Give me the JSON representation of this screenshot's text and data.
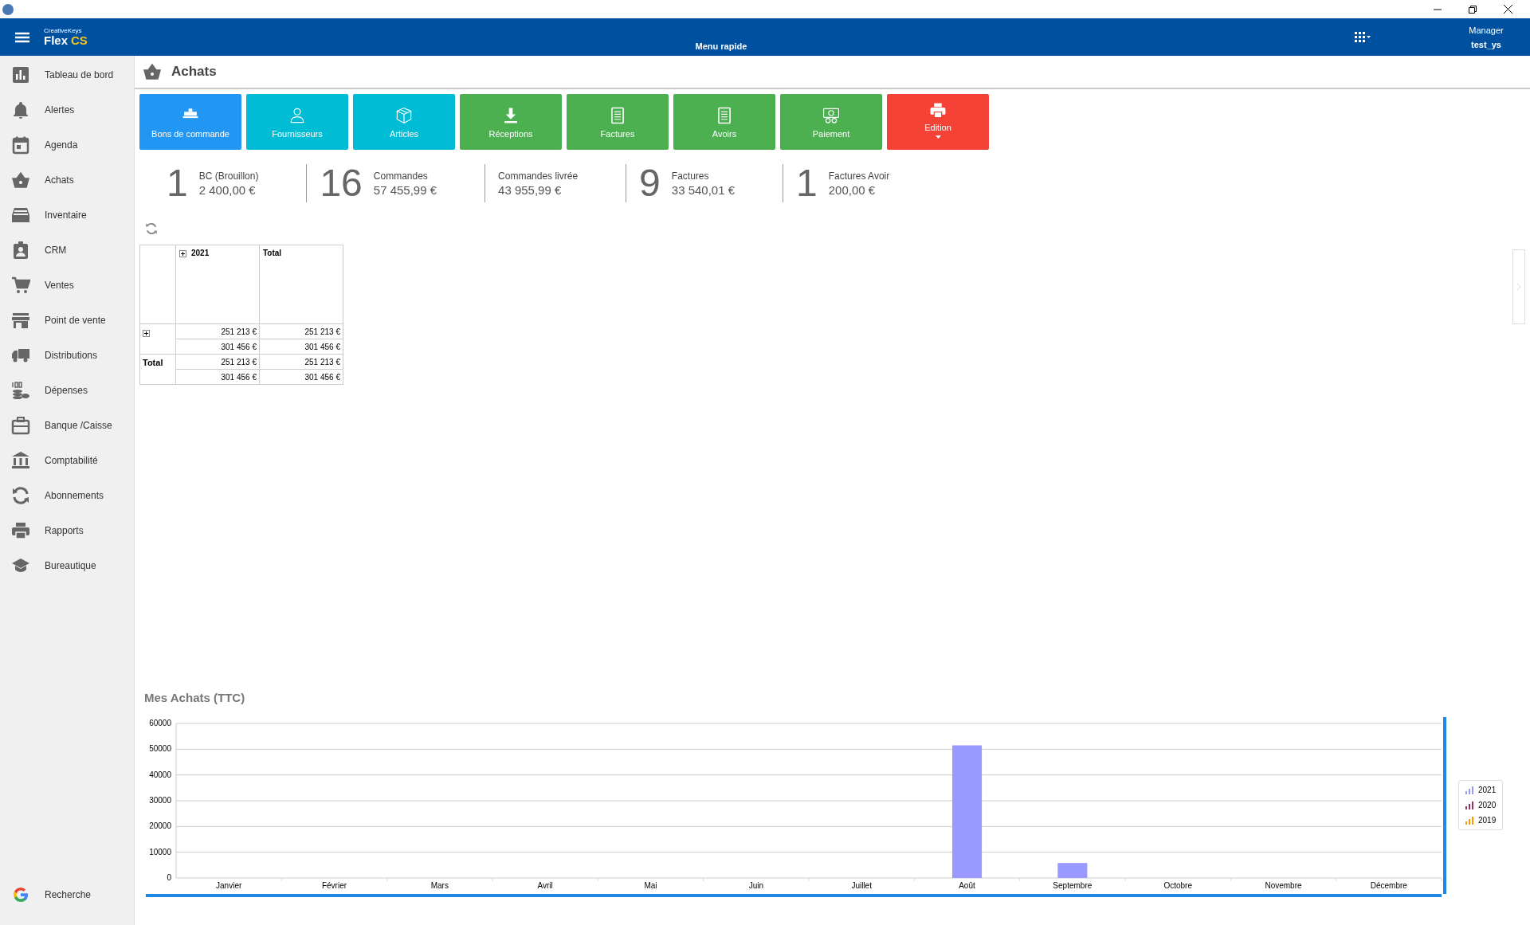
{
  "header": {
    "brand_small": "CreativeKeys",
    "brand_name": "Flex",
    "brand_suffix": "CS",
    "center": "Menu rapide",
    "role": "Manager",
    "user": "test_ys"
  },
  "sidebar": {
    "items": [
      {
        "label": "Tableau de bord",
        "kind": "chart"
      },
      {
        "label": "Alertes",
        "kind": "bell"
      },
      {
        "label": "Agenda",
        "kind": "calendar"
      },
      {
        "label": "Achats",
        "kind": "basket"
      },
      {
        "label": "Inventaire",
        "kind": "tray"
      },
      {
        "label": "CRM",
        "kind": "badge"
      },
      {
        "label": "Ventes",
        "kind": "cart"
      },
      {
        "label": "Point de vente",
        "kind": "store"
      },
      {
        "label": "Distributions",
        "kind": "truck"
      },
      {
        "label": "Dépenses",
        "kind": "coins"
      },
      {
        "label": "Banque /Caisse",
        "kind": "briefcase"
      },
      {
        "label": "Comptabilité",
        "kind": "bank"
      },
      {
        "label": "Abonnements",
        "kind": "sync"
      },
      {
        "label": "Rapports",
        "kind": "printer"
      },
      {
        "label": "Bureautique",
        "kind": "cap"
      }
    ],
    "search": {
      "label": "Recherche"
    }
  },
  "page": {
    "title": "Achats"
  },
  "tiles": [
    {
      "label": "Bons de commande",
      "kind": "pallet",
      "color": "#2196f3"
    },
    {
      "label": "Fournisseurs",
      "kind": "person",
      "color": "#00bcd4"
    },
    {
      "label": "Articles",
      "kind": "box",
      "color": "#00bcd4"
    },
    {
      "label": "Réceptions",
      "kind": "download",
      "color": "#4caf50"
    },
    {
      "label": "Factures",
      "kind": "doc",
      "color": "#4caf50"
    },
    {
      "label": "Avoirs",
      "kind": "doc",
      "color": "#4caf50"
    },
    {
      "label": "Paiement",
      "kind": "money",
      "color": "#4caf50"
    },
    {
      "label": "Edition",
      "kind": "printer",
      "color": "#f44336",
      "dropdown": true
    }
  ],
  "stats": [
    {
      "count": "1",
      "label": "BC (Brouillon)",
      "amount": "2 400,00 €"
    },
    {
      "count": "16",
      "label": "Commandes",
      "amount": "57 455,99 €"
    },
    {
      "label": "Commandes livrée",
      "amount": "43 955,99 €"
    },
    {
      "count": "9",
      "label": "Factures",
      "amount": "33 540,01 €"
    },
    {
      "count": "1",
      "label": "Factures Avoir",
      "amount": "200,00 €"
    }
  ],
  "pivot": {
    "columns": [
      {
        "label": "2021",
        "expandable": true
      },
      {
        "label": "Total",
        "expandable": false
      }
    ],
    "rows": [
      {
        "label": "",
        "expandable": true,
        "values": [
          [
            "251 213 €",
            "251 213 €"
          ],
          [
            "301 456 €",
            "301 456 €"
          ]
        ]
      },
      {
        "label": "Total",
        "expandable": false,
        "values": [
          [
            "251 213 €",
            "251 213 €"
          ],
          [
            "301 456 €",
            "301 456 €"
          ]
        ]
      }
    ]
  },
  "chart": {
    "title": "Mes Achats (TTC)",
    "chart_data": {
      "type": "bar",
      "categories": [
        "Janvier",
        "Février",
        "Mars",
        "Avril",
        "Mai",
        "Juin",
        "Juillet",
        "Août",
        "Septembre",
        "Octobre",
        "Novembre",
        "Décembre"
      ],
      "series": [
        {
          "name": "2021",
          "color": "#9999ff",
          "values": [
            0,
            0,
            0,
            0,
            0,
            0,
            0,
            51500,
            5800,
            0,
            0,
            0
          ]
        },
        {
          "name": "2020",
          "color": "#993366",
          "values": [
            null,
            null,
            null,
            null,
            null,
            null,
            null,
            null,
            null,
            null,
            null,
            null
          ]
        },
        {
          "name": "2019",
          "color": "#ff9900",
          "values": [
            null,
            null,
            null,
            null,
            null,
            null,
            null,
            null,
            null,
            null,
            null,
            null
          ]
        }
      ],
      "grid": true,
      "ylim": [
        0,
        60000
      ],
      "yticks": [
        0,
        10000,
        20000,
        30000,
        40000,
        50000,
        60000
      ]
    }
  }
}
